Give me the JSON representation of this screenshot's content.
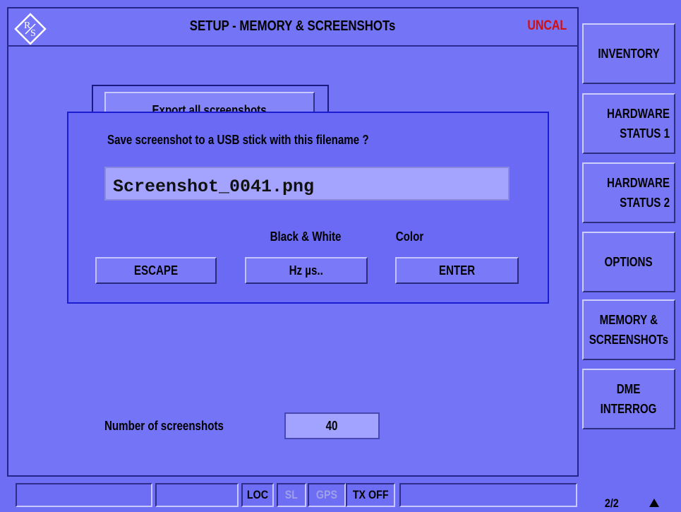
{
  "header": {
    "title": "SETUP - MEMORY & SCREENSHOTs",
    "status": "UNCAL",
    "status_color": "#d01010",
    "logo_icon": "rs-logo-icon"
  },
  "background_panel": {
    "export_button": "Export all screenshots"
  },
  "dialog": {
    "question": "Save screenshot to a USB stick with this filename ?",
    "filename": "Screenshot_0041.png",
    "bw_label": "Black & White",
    "color_label": "Color",
    "buttons": {
      "escape": "ESCAPE",
      "hz": "Hz µs..",
      "enter": "ENTER"
    }
  },
  "screenshots": {
    "label": "Number of screenshots",
    "value": "40"
  },
  "softkeys": {
    "inventory": "INVENTORY",
    "hw1_line1": "HARDWARE",
    "hw1_line2": "STATUS 1",
    "hw2_line1": "HARDWARE",
    "hw2_line2": "STATUS 2",
    "options": "OPTIONS",
    "memory_line1": "MEMORY &",
    "memory_line2": "SCREENSHOTs",
    "dme_line1": "DME",
    "dme_line2": "INTERROG"
  },
  "statusbar": {
    "loc": "LOC",
    "sl": "SL",
    "gps": "GPS",
    "tx": "TX OFF",
    "page": "2/2",
    "page_icon": "up-arrow-icon"
  }
}
